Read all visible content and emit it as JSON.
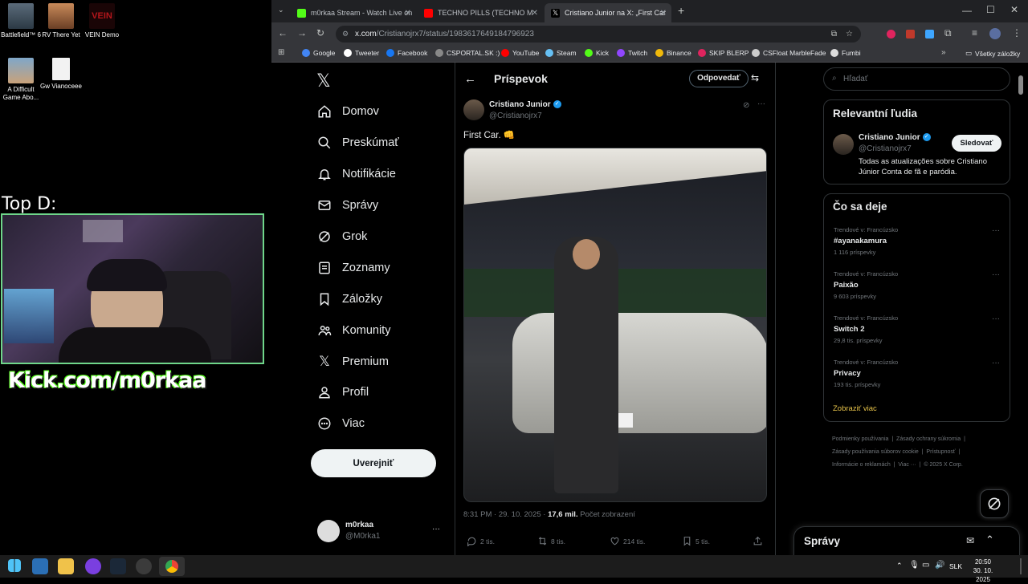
{
  "desktop": {
    "icons": [
      {
        "label": "Battlefield™ 6"
      },
      {
        "label": "RV There Yet"
      },
      {
        "label": "VEIN Demo"
      },
      {
        "label": "A Difficult Game Abo..."
      },
      {
        "label": "Gw Vianoceee"
      }
    ],
    "overlay_title": "Top D:",
    "kick_overlay": "Kick.com/m0rkaa"
  },
  "browser": {
    "tabs": [
      {
        "title": "m0rkaa Stream - Watch Live on",
        "fav_color": "#53fc18",
        "active": false
      },
      {
        "title": "TECHNO PILLS (TECHNO M",
        "fav_color": "#ff0000",
        "active": false
      },
      {
        "title": "Cristiano Junior na X: „First Car",
        "fav_color": "#ffffff",
        "active": true
      }
    ],
    "url_host": "x.com",
    "url_path": "/Cristianojrx7/status/1983617649184796923",
    "bookmarks": [
      {
        "label": "Google",
        "color": "#4285f4"
      },
      {
        "label": "Tweeter",
        "color": "#ffffff"
      },
      {
        "label": "Facebook",
        "color": "#1877f2"
      },
      {
        "label": "CSPORTAL.SK :)",
        "color": "#888888"
      },
      {
        "label": "YouTube",
        "color": "#ff0000"
      },
      {
        "label": "Steam",
        "color": "#66c0f4"
      },
      {
        "label": "Kick",
        "color": "#53fc18"
      },
      {
        "label": "Twitch",
        "color": "#9146ff"
      },
      {
        "label": "Binance",
        "color": "#f0b90b"
      },
      {
        "label": "SKIP BLERP",
        "color": "#e0245e"
      },
      {
        "label": "CSFloat MarbleFade",
        "color": "#cccccc"
      },
      {
        "label": "Fumbi",
        "color": "#dddddd"
      }
    ],
    "all_bookmarks": "Všetky záložky"
  },
  "x": {
    "nav": [
      {
        "label": "Domov"
      },
      {
        "label": "Preskúmať"
      },
      {
        "label": "Notifikácie"
      },
      {
        "label": "Správy"
      },
      {
        "label": "Grok"
      },
      {
        "label": "Zoznamy"
      },
      {
        "label": "Záložky"
      },
      {
        "label": "Komunity"
      },
      {
        "label": "Premium"
      },
      {
        "label": "Profil"
      },
      {
        "label": "Viac"
      }
    ],
    "post_button": "Uverejniť",
    "account": {
      "name": "m0rkaa",
      "handle": "@M0rka1"
    },
    "header_title": "Príspevok",
    "reply_button": "Odpovedať",
    "tweet": {
      "author": "Cristiano Junior",
      "handle": "@Cristianojrx7",
      "text": "First Car. 👊",
      "timestamp": "8:31 PM · 29. 10. 2025 · ",
      "views_count": "17,6 mil.",
      "views_label": " Počet zobrazení",
      "replies": "2 tis.",
      "reposts": "8 tis.",
      "likes": "214 tis.",
      "bookmarks": "5 tis."
    },
    "search_placeholder": "Hľadať",
    "relevant": {
      "title": "Relevantní ľudia",
      "name": "Cristiano Junior",
      "handle": "@Cristianojrx7",
      "follow": "Sledovať",
      "bio": "Todas as atualizações sobre Cristiano Júnior Conta de fã e paródia."
    },
    "trends_title": "Čo sa deje",
    "trends": [
      {
        "meta": "Trendové v: Francúzsko",
        "name": "#ayanakamura",
        "count": "1 116 príspevky"
      },
      {
        "meta": "Trendové v: Francúzsko",
        "name": "Paixão",
        "count": "9 603 príspevky"
      },
      {
        "meta": "Trendové v: Francúzsko",
        "name": "Switch 2",
        "count": "29,8 tis. príspevky"
      },
      {
        "meta": "Trendové v: Francúzsko",
        "name": "Privacy",
        "count": "193 tis. príspevky"
      }
    ],
    "show_more": "Zobraziť viac",
    "footer": {
      "l1a": "Podmienky používania",
      "l1b": "Zásady ochrany súkromia",
      "l2a": "Zásady používania súborov cookie",
      "l2b": "Prístupnosť",
      "l3a": "Informácie o reklamách",
      "l3b": "Viac ···",
      "l3c": "© 2025 X Corp."
    },
    "messages_title": "Správy"
  },
  "taskbar": {
    "lang": "SLK",
    "time": "20:50",
    "date": "30. 10. 2025"
  }
}
